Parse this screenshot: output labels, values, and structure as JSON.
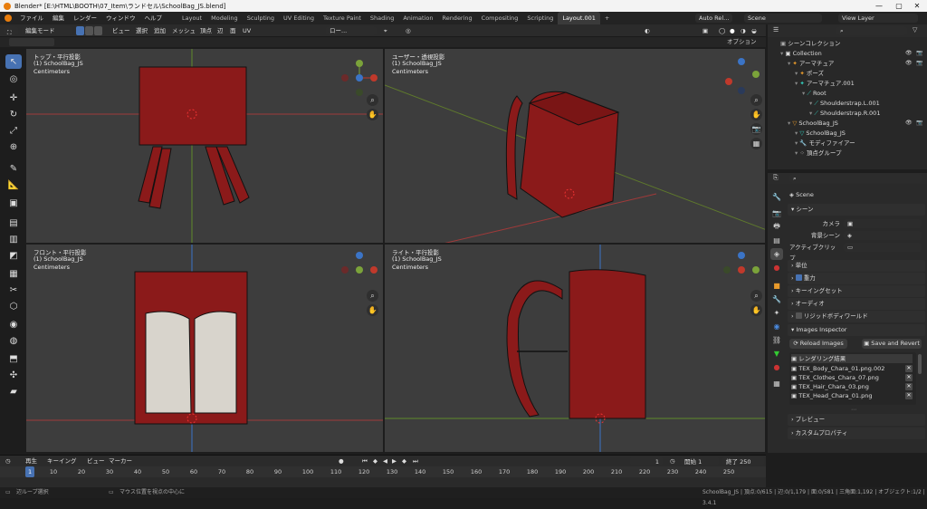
{
  "window": {
    "title": "Blender* [E:\\HTML\\BOOTH\\07_Item\\ランドセル\\SchoolBag_JS.blend]"
  },
  "menu": [
    "ファイル",
    "編集",
    "レンダー",
    "ウィンドウ",
    "ヘルプ"
  ],
  "workspaces": [
    "Layout",
    "Modeling",
    "Sculpting",
    "UV Editing",
    "Texture Paint",
    "Shading",
    "Animation",
    "Rendering",
    "Compositing",
    "Scripting",
    "Layout.001"
  ],
  "workspace_add": "+",
  "topright": {
    "autorel": "Auto Rel...",
    "scene": "Scene",
    "view_layer": "View Layer"
  },
  "header3d": {
    "mode": "編集モード",
    "menus": [
      "ビュー",
      "選択",
      "追加",
      "メッシュ",
      "頂点",
      "辺",
      "面",
      "UV"
    ],
    "transform": "ロー...",
    "options": "オプション"
  },
  "viewports": [
    {
      "title": "トップ・平行投影",
      "object": "(1) SchoolBag_JS",
      "units": "Centimeters"
    },
    {
      "title": "ユーザー・透視投影",
      "object": "(1) SchoolBag_JS",
      "units": "Centimeters"
    },
    {
      "title": "フロント・平行投影",
      "object": "(1) SchoolBag_JS",
      "units": "Centimeters"
    },
    {
      "title": "ライト・平行投影",
      "object": "(1) SchoolBag_JS",
      "units": "Centimeters"
    }
  ],
  "gizmo": {
    "x": "X",
    "y": "Y",
    "z": "Z"
  },
  "timeline": {
    "menus": [
      "再生",
      "キーイング",
      "ビュー",
      "マーカー"
    ],
    "current_frame": "1",
    "start_label": "開始",
    "start": "1",
    "end_label": "終了",
    "end": "250",
    "ticks": [
      "1",
      "10",
      "20",
      "30",
      "40",
      "50",
      "60",
      "70",
      "80",
      "90",
      "100",
      "110",
      "120",
      "130",
      "140",
      "150",
      "160",
      "170",
      "180",
      "190",
      "200",
      "210",
      "220",
      "230",
      "240",
      "250"
    ]
  },
  "status": {
    "left": "辺ループ選択",
    "mid": "マウス位置を視点の中心に",
    "right": "SchoolBag_JS | 頂点:0/615 | 辺:0/1,179 | 面:0/581 | 三角面:1,192 | オブジェクト:1/2 | 3.4.1"
  },
  "outliner": {
    "root": "シーンコレクション",
    "items": [
      {
        "label": "Collection",
        "indent": 1,
        "icon": "collection-icon",
        "vis": true
      },
      {
        "label": "アーマチュア",
        "indent": 2,
        "icon": "armature-icon",
        "vis": true
      },
      {
        "label": "ポーズ",
        "indent": 3,
        "icon": "pose-icon",
        "vis": false
      },
      {
        "label": "アーマチュア.001",
        "indent": 3,
        "icon": "armature-data-icon",
        "vis": false
      },
      {
        "label": "Root",
        "indent": 4,
        "icon": "bone-icon",
        "vis": false
      },
      {
        "label": "Shoulderstrap.L.001",
        "indent": 5,
        "icon": "bone-icon",
        "vis": false
      },
      {
        "label": "Shoulderstrap.R.001",
        "indent": 5,
        "icon": "bone-icon",
        "vis": false
      },
      {
        "label": "SchoolBag_JS",
        "indent": 2,
        "icon": "mesh-object-icon",
        "vis": true
      },
      {
        "label": "SchoolBag_JS",
        "indent": 3,
        "icon": "mesh-data-icon",
        "vis": false
      },
      {
        "label": "モディファイアー",
        "indent": 3,
        "icon": "wrench-icon",
        "vis": false
      },
      {
        "label": "頂点グループ",
        "indent": 3,
        "icon": "vertex-group-icon",
        "vis": false
      }
    ]
  },
  "properties": {
    "scene_name": "Scene",
    "scene_section": "シーン",
    "camera_label": "カメラ",
    "bg_scene_label": "背景シーン",
    "active_clip_label": "アクティブクリップ",
    "sections": [
      "単位",
      "重力",
      "キーイングセット",
      "オーディオ",
      "リジッドボディワールド"
    ],
    "images_inspector": "Images Inspector",
    "reload_images": "Reload Images",
    "save_revert": "Save and Revert",
    "render_result": "レンダリング結果",
    "images": [
      "TEX_Body_Chara_01.png.002",
      "TEX_Clothes_Chara_07.png",
      "TEX_Hair_Chara_03.png",
      "TEX_Head_Chara_01.png"
    ],
    "preview": "プレビュー",
    "custom_props": "カスタムプロパティ",
    "remove_x": "✕"
  },
  "colors": {
    "accent": "#4772b3",
    "mesh_red": "#8b1a1a",
    "viewport_bg": "#3d3d3d",
    "axis_x": "#c0392b",
    "axis_y": "#7ba33a",
    "axis_z": "#3b74c6"
  }
}
